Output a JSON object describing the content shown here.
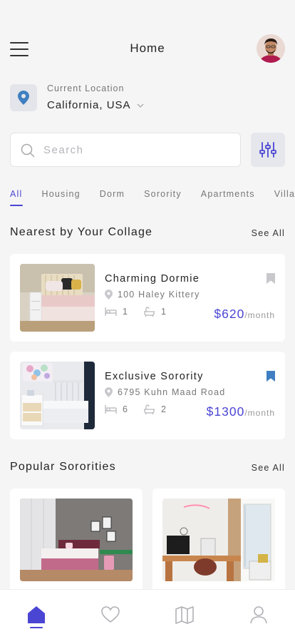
{
  "header": {
    "title": "Home"
  },
  "location": {
    "label": "Current Location",
    "value": "California, USA"
  },
  "search": {
    "placeholder": "Search"
  },
  "tabs": [
    {
      "label": "All",
      "active": true
    },
    {
      "label": "Housing",
      "active": false
    },
    {
      "label": "Dorm",
      "active": false
    },
    {
      "label": "Sorority",
      "active": false
    },
    {
      "label": "Apartments",
      "active": false
    },
    {
      "label": "Villa",
      "active": false
    }
  ],
  "nearest": {
    "title": "Nearest by Your Collage",
    "see_all": "See All",
    "items": [
      {
        "title": "Charming Dormie",
        "address": "100 Haley Kittery",
        "beds": "1",
        "baths": "1",
        "price": "$620",
        "price_unit": "/month",
        "bookmarked": false
      },
      {
        "title": "Exclusive Sorority",
        "address": "6795 Kuhn Maad Road",
        "beds": "6",
        "baths": "2",
        "price": "$1300",
        "price_unit": "/month",
        "bookmarked": true
      }
    ]
  },
  "popular": {
    "title": "Popular Sororities",
    "see_all": "See All"
  },
  "colors": {
    "accent": "#4b45d3",
    "background": "#f5f5f6",
    "location_pin": "#3f7fc1",
    "bookmark_inactive": "#c8c8cc",
    "bookmark_active": "#3f7fc1"
  },
  "icons": {
    "menu": "hamburger-icon",
    "location": "map-pin-icon",
    "search": "search-icon",
    "filter": "sliders-icon",
    "bed": "bed-icon",
    "bath": "bathtub-icon",
    "bookmark": "bookmark-icon",
    "nav": [
      "home-icon",
      "heart-icon",
      "map-icon",
      "user-icon"
    ]
  }
}
